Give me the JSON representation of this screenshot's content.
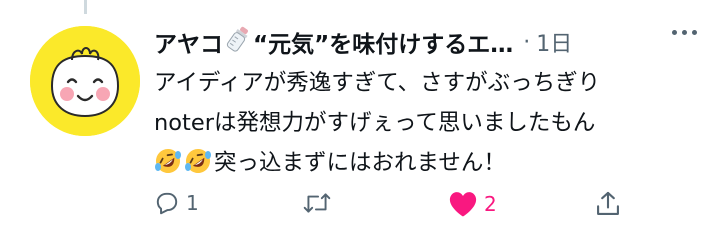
{
  "tweet": {
    "author_name": "アヤコ",
    "author_name_suffix": "“元気”を味付けするエ…",
    "separator": "·",
    "time": "1日",
    "lines": [
      "アイディアが秀逸すぎて、さすがぶっちぎり",
      "noterは発想力がすげぇって思いましたもん",
      "突っ込まずにはおれません！"
    ],
    "emojis": [
      "rolling-on-floor-laughing",
      "rolling-on-floor-laughing"
    ],
    "name_emoji": "baby-bottle"
  },
  "actions": {
    "reply_count": "1",
    "retweet_count": "",
    "like_count": "2",
    "liked": true
  },
  "colors": {
    "like": "#f91880",
    "muted": "#536471",
    "avatar_bg": "#fbe92a",
    "text": "#0f1419"
  }
}
